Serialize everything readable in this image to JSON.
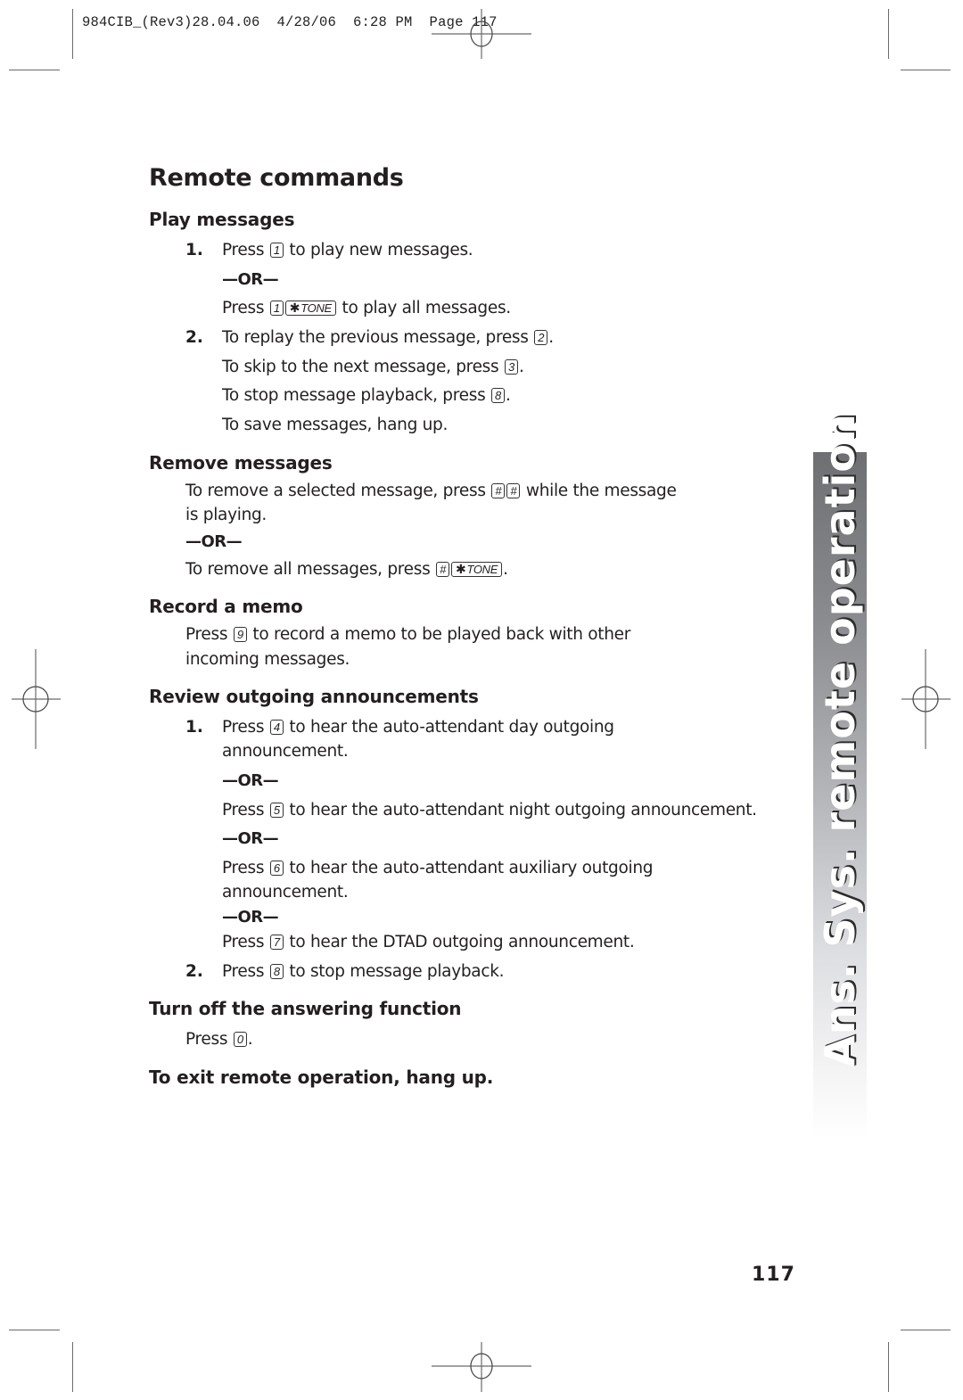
{
  "slug": "984CIB_(Rev3)28.04.06  4/28/06  6:28 PM  Page 117",
  "title": "Remote commands",
  "sections": {
    "play": {
      "heading": "Play messages",
      "item1_num": "1.",
      "item1_a_pre": "Press",
      "item1_a_key": "1",
      "item1_a_post": "to play new messages.",
      "or1": "—OR—",
      "item1_b_pre": "Press",
      "item1_b_key1": "1",
      "item1_b_key2_star": "✱",
      "item1_b_key2_label": "TONE",
      "item1_b_post": "to play all messages.",
      "item2_num": "2.",
      "item2_a_pre": "To replay the previous message, press",
      "item2_a_key": "2",
      "item2_b_pre": "To skip to the next message, press",
      "item2_b_key": "3",
      "item2_c_pre": "To stop message playback, press",
      "item2_c_key": "8",
      "item2_d": "To save messages, hang up."
    },
    "remove": {
      "heading": "Remove messages",
      "line1_pre": "To remove a selected message, press",
      "line1_key1": "#",
      "line1_key2": "#",
      "line1_post": "while the message",
      "line2": "is playing.",
      "or": "—OR—",
      "line3_pre": "To remove all messages, press",
      "line3_key1": "#",
      "line3_key2_star": "✱",
      "line3_key2_label": "TONE"
    },
    "memo": {
      "heading": "Record a memo",
      "line1_pre": "Press",
      "line1_key": "9",
      "line1_post": "to record a memo to be played back with other",
      "line2": "incoming messages."
    },
    "review": {
      "heading": "Review outgoing announcements",
      "item1_num": "1.",
      "a_pre": "Press",
      "a_key": "4",
      "a_post": "to hear the auto-attendant day outgoing",
      "a_line2": "announcement.",
      "or1": "—OR—",
      "b_pre": "Press",
      "b_key": "5",
      "b_post": "to hear the auto-attendant night outgoing announcement.",
      "or2": "—OR—",
      "c_pre": "Press",
      "c_key": "6",
      "c_post": "to hear the auto-attendant auxiliary outgoing",
      "c_line2": "announcement.",
      "or3": "—OR—",
      "d_pre": "Press",
      "d_key": "7",
      "d_post": "to hear the DTAD outgoing announcement.",
      "item2_num": "2.",
      "e_pre": "Press",
      "e_key": "8",
      "e_post": "to stop message playback."
    },
    "turnoff": {
      "heading": "Turn off the answering function",
      "line_pre": "Press",
      "line_key": "0"
    },
    "exit": {
      "heading": "To exit remote operation, hang up."
    }
  },
  "page_number": "117",
  "side_tab": {
    "label": "Ans. Sys. remote operation"
  }
}
